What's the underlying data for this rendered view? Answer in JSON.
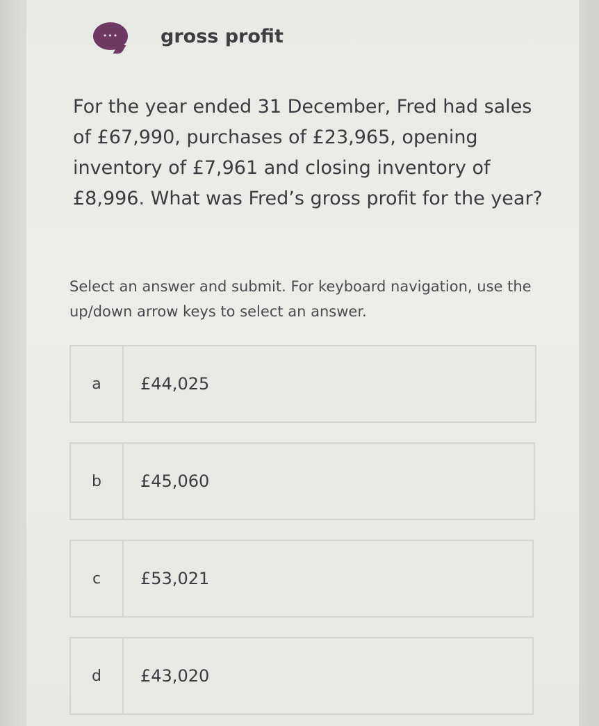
{
  "header": {
    "title": "gross profit",
    "icon": "chat-bubble-icon",
    "icon_text": "•••",
    "accent_color": "#6e3a64"
  },
  "question": {
    "text": "For the year ended 31 December, Fred had sales of £67,990, purchases of £23,965, opening inventory of £7,961 and closing inventory of £8,996. What was Fred’s gross profit for the year?"
  },
  "instructions": {
    "text": "Select an answer and submit. For keyboard navigation, use the up/down arrow keys to select an answer."
  },
  "options": [
    {
      "letter": "a",
      "value": "£44,025"
    },
    {
      "letter": "b",
      "value": "£45,060"
    },
    {
      "letter": "c",
      "value": "£53,021"
    },
    {
      "letter": "d",
      "value": "£43,020"
    }
  ]
}
